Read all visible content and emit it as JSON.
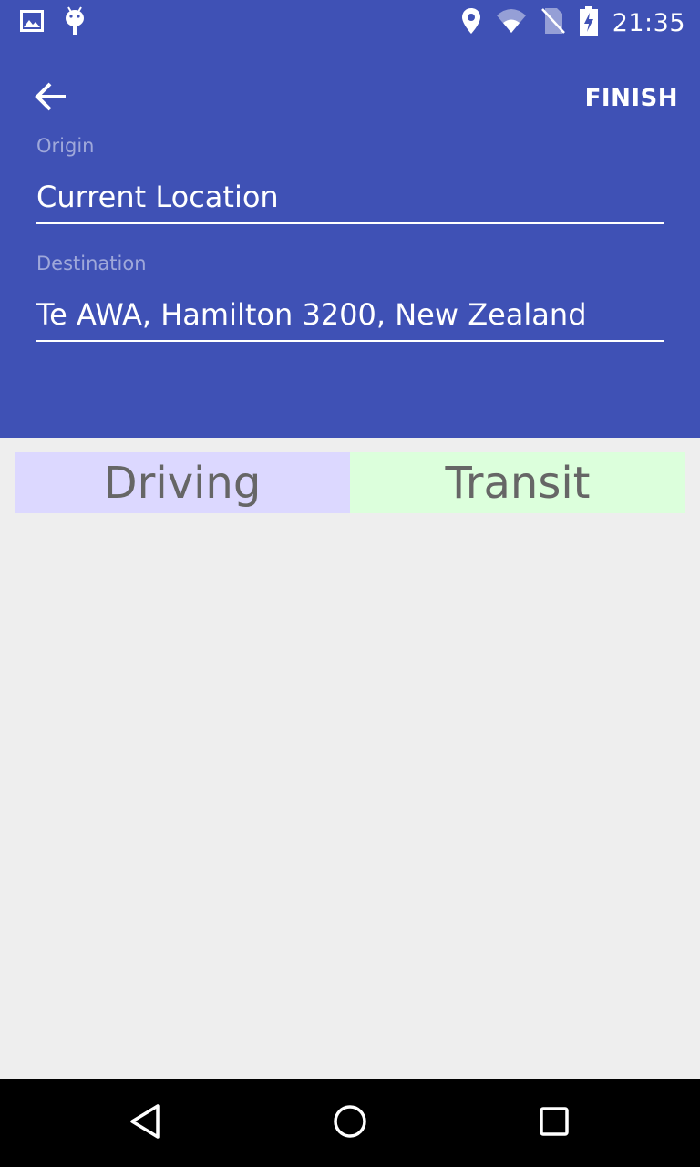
{
  "status_bar": {
    "time": "21:35",
    "icons_left": [
      "image-notification-icon",
      "android-debug-icon"
    ],
    "icons_right": [
      "location-icon",
      "wifi-icon",
      "no-sim-icon",
      "battery-charging-icon"
    ]
  },
  "toolbar": {
    "back_icon": "arrow-back-icon",
    "finish_label": "FINISH"
  },
  "form": {
    "origin": {
      "label": "Origin",
      "value": "Current Location"
    },
    "destination": {
      "label": "Destination",
      "value": "Te AWA, Hamilton 3200, New Zealand"
    }
  },
  "modes": {
    "driving_label": "Driving",
    "transit_label": "Transit"
  },
  "nav_bar": {
    "back_icon": "triangle-back-icon",
    "home_icon": "circle-home-icon",
    "recents_icon": "square-recents-icon"
  },
  "colors": {
    "primary": "#3f51b5",
    "driving_bg": "#dcd8ff",
    "transit_bg": "#dcffdc",
    "background": "#eeeeee"
  }
}
